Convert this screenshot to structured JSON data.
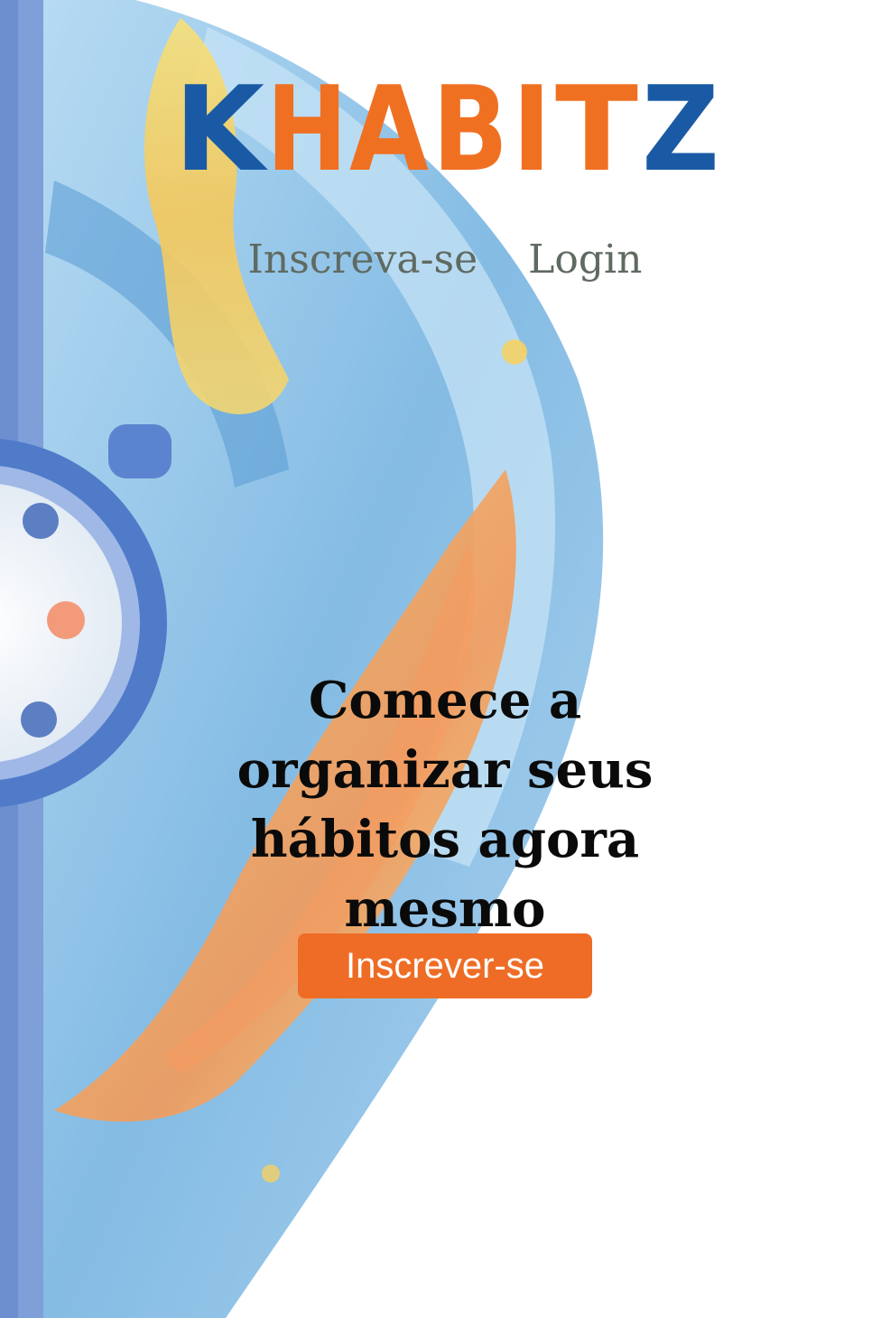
{
  "brand": {
    "name": "KHABITZ",
    "letters": [
      "K",
      "H",
      "A",
      "B",
      "I",
      "T",
      "Z"
    ],
    "colors": {
      "blue": "#1a5aa5",
      "orange": "#f07022"
    }
  },
  "nav": {
    "items": [
      {
        "label": "Inscreva-se"
      },
      {
        "label": "Login"
      }
    ]
  },
  "hero": {
    "headline": "Comece a organizar seus hábitos agora mesmo",
    "cta_label": "Inscrever-se",
    "background_icon": "clock-paint-splash"
  },
  "theme": {
    "accent": "#ee6c25",
    "nav_text": "#5f6a61",
    "headline_text": "#0a0a0a",
    "paint_blue": "#7ab8e2",
    "paint_yellow": "#f4d35e"
  }
}
